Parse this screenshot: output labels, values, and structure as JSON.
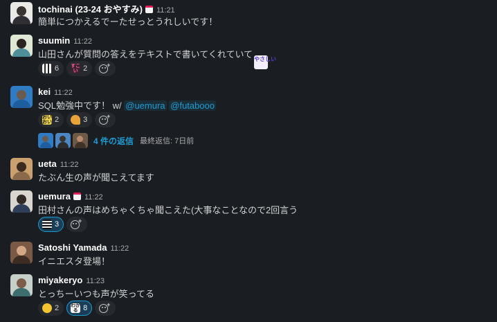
{
  "messages": [
    {
      "name": "tochinai (23-24 おやすみ)",
      "time": "11:21",
      "text": "簡単につかえるでーたせっとうれしいです！"
    },
    {
      "name": "suumin",
      "time": "11:22",
      "text": "山田さんが質問の答えをテキストで書いてくれていて",
      "inline_emoji": "やさしい",
      "reactions": [
        {
          "emoji": "qr-code-emoji",
          "count": "6"
        },
        {
          "emoji": "sugoi-text-emoji",
          "count": "2"
        }
      ]
    },
    {
      "name": "kei",
      "time": "11:22",
      "text": "SQL勉強中です！ w/",
      "mentions": [
        "@uemura",
        "@futabooo"
      ],
      "reactions": [
        {
          "emoji": "omoi-text-emoji",
          "count": "2"
        },
        {
          "emoji": "party-emoji",
          "count": "3"
        }
      ],
      "thread": {
        "count_label": "4 件の返信",
        "last_label": "最終返信: 7日前"
      }
    },
    {
      "name": "ueta",
      "time": "11:22",
      "text": "たぶん生の声が聞こえてます"
    },
    {
      "name": "uemura",
      "time": "11:22",
      "text": "田村さんの声はめちゃくちゃ聞こえた(大事なことなので2回言う",
      "reactions": [
        {
          "emoji": "pixel-emoji",
          "count": "3",
          "mine": true
        }
      ]
    },
    {
      "name": "Satoshi Yamada",
      "time": "11:22",
      "text": "イニエスタ登場！"
    },
    {
      "name": "miyakeryo",
      "time": "11:23",
      "text": "とっちーいつも声が笑ってる",
      "reactions": [
        {
          "emoji": "joy-emoji",
          "count": "2"
        },
        {
          "emoji": "wakaru-text-emoji",
          "count": "8",
          "mine": true
        }
      ]
    }
  ],
  "colors": {
    "background": "#1a1d21",
    "link": "#1d9bd1",
    "reaction_bg": "#26292d",
    "reaction_mine_bg": "#1a3e58"
  }
}
